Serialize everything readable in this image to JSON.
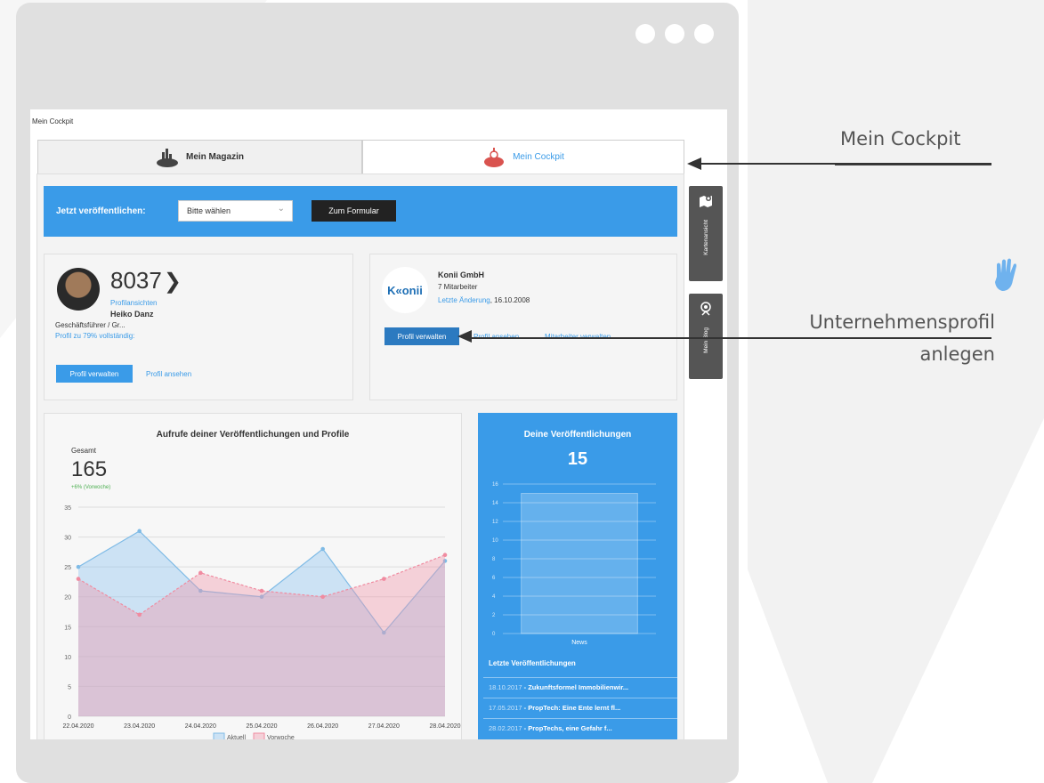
{
  "breadcrumb": "Mein Cockpit",
  "tabs": [
    {
      "label": "Mein Magazin",
      "active": false
    },
    {
      "label": "Mein Cockpit",
      "active": true
    }
  ],
  "publish": {
    "label": "Jetzt veröffentlichen:",
    "select_value": "Bitte wählen",
    "button": "Zum Formular"
  },
  "profile": {
    "views": "8037",
    "views_label": "Profilansichten",
    "name": "Heiko Danz",
    "role": "Geschäftsführer / Gr...",
    "completeness": "Profil zu 79% vollständig:",
    "manage_button": "Profil verwalten",
    "view_link": "Profil ansehen"
  },
  "company": {
    "logo_text": "K«onii",
    "name": "Konii GmbH",
    "employees": "7 Mitarbeiter",
    "last_change_label": "Letzte Änderung",
    "last_change_date": "16.10.2008",
    "manage_button": "Profil verwalten",
    "view_link": "Profil ansehen",
    "employees_link": "Mitarbeiter verwalten"
  },
  "stats": {
    "title": "Aufrufe deiner Veröffentlichungen und Profile",
    "total_label": "Gesamt",
    "total_value": "165",
    "delta": "+6% (Vorwoche)"
  },
  "publications": {
    "title": "Deine Veröffentlichungen",
    "count": "15",
    "recent_title": "Letzte Veröffentlichungen",
    "recent": [
      {
        "date": "18.10.2017",
        "title": " - Zukunftsformel Immobilienwir..."
      },
      {
        "date": "17.05.2017",
        "title": " - PropTech: Eine Ente lernt fl..."
      },
      {
        "date": "28.02.2017",
        "title": " - PropTechs, eine Gefahr f..."
      }
    ]
  },
  "side_tabs": [
    {
      "label": "Kartenansicht",
      "icon": "map-icon"
    },
    {
      "label": "Mein Blog",
      "icon": "blog-icon"
    }
  ],
  "annotations": {
    "cockpit": "Mein Cockpit",
    "company_line1": "Unternehmensprofil",
    "company_line2": "anlegen"
  },
  "colors": {
    "accent": "#3a9be8",
    "current_series": "#7fbbe6",
    "previous_series": "#f08ba0",
    "window": "#e0e0e0"
  },
  "chart_data": [
    {
      "type": "area",
      "title": "Aufrufe deiner Veröffentlichungen und Profile",
      "x": [
        "22.04.2020",
        "23.04.2020",
        "24.04.2020",
        "25.04.2020",
        "26.04.2020",
        "27.04.2020",
        "28.04.2020"
      ],
      "series": [
        {
          "name": "Aktuell",
          "values": [
            25,
            31,
            21,
            20,
            28,
            14,
            26
          ]
        },
        {
          "name": "Vorwoche",
          "values": [
            23,
            17,
            24,
            21,
            20,
            23,
            27
          ]
        }
      ],
      "ylim": [
        0,
        35
      ],
      "yticks": [
        0,
        5,
        10,
        15,
        20,
        25,
        30,
        35
      ],
      "grid": true,
      "legend": "bottom"
    },
    {
      "type": "bar",
      "categories": [
        "News"
      ],
      "values": [
        15
      ],
      "ylim": [
        0,
        16
      ],
      "yticks": [
        0,
        2,
        4,
        6,
        8,
        10,
        12,
        14,
        16
      ],
      "grid": true
    }
  ]
}
